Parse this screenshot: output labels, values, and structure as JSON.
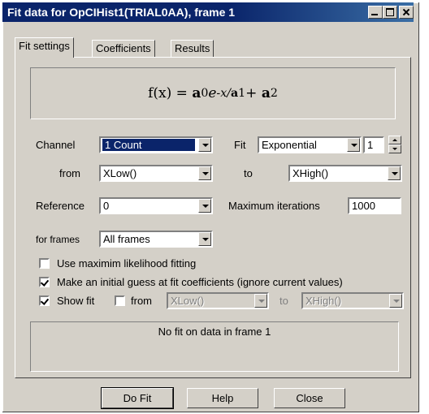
{
  "window": {
    "title": "Fit data for OpCIHist1(TRIAL0AA), frame 1"
  },
  "tabs": [
    "Fit settings",
    "Coefficients",
    "Results"
  ],
  "formula": {
    "f": "f(x) = ",
    "a0": "a",
    "s0": "0",
    "e": "e",
    "exp": "-x/",
    "a1": "a",
    "s1": "1",
    "plus": " + ",
    "a2": "a",
    "s2": "2"
  },
  "form": {
    "channel_label": "Channel",
    "channel_value": "1 Count",
    "fit_label": "Fit",
    "fit_value": "Exponential",
    "fit_order": "1",
    "from_label": "from",
    "from_value": "XLow()",
    "to_label": "to",
    "to_value": "XHigh()",
    "reference_label": "Reference",
    "reference_value": "0",
    "max_iter_label": "Maximum iterations",
    "max_iter_value": "1000",
    "frames_label": "for frames",
    "frames_value": "All frames"
  },
  "options": {
    "max_likelihood": {
      "label": "Use maximim likelihood fitting",
      "checked": false
    },
    "initial_guess": {
      "label": "Make an initial guess at fit coefficients (ignore current values)",
      "checked": true
    },
    "show_fit": {
      "label": "Show fit",
      "checked": true
    },
    "show_from": {
      "label": "from",
      "checked": false,
      "value": "XLow()"
    },
    "show_to": {
      "label": "to",
      "value": "XHigh()"
    }
  },
  "status": "No fit on data in frame 1",
  "buttons": {
    "do_fit": "Do Fit",
    "help": "Help",
    "close": "Close"
  }
}
